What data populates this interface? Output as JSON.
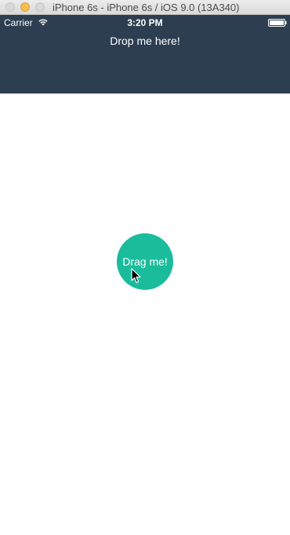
{
  "window": {
    "title": "iPhone 6s - iPhone 6s / iOS 9.0 (13A340)",
    "buttons": [
      "close",
      "minimize",
      "zoom"
    ]
  },
  "status_bar": {
    "carrier": "Carrier",
    "time": "3:20 PM",
    "icons": [
      "wifi-icon",
      "battery-icon"
    ]
  },
  "drop_zone": {
    "label": "Drop me here!",
    "color": "#2c3e50"
  },
  "draggable": {
    "label": "Drag me!",
    "color": "#1abc9c"
  },
  "cursor": {
    "icon": "arrow-cursor-icon"
  }
}
